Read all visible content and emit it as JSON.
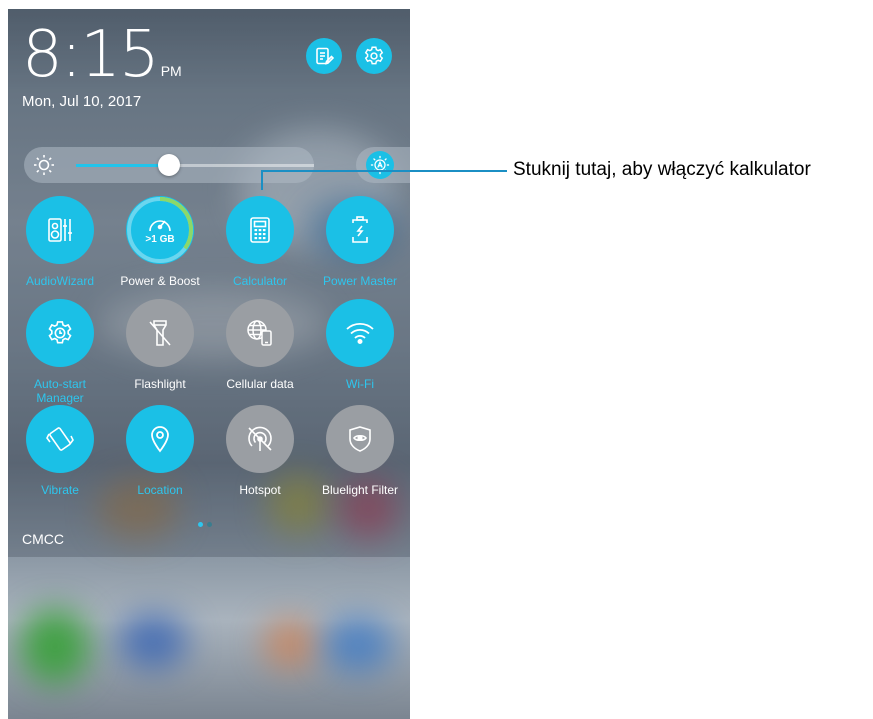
{
  "status": {
    "time_hm": "8:15",
    "ampm": "PM",
    "date": "Mon, Jul 10, 2017",
    "carrier": "CMCC"
  },
  "top_actions": [
    {
      "name": "notes-button",
      "icon": "notes-edit-icon"
    },
    {
      "name": "settings-button",
      "icon": "gear-icon"
    }
  ],
  "brightness": {
    "level_fraction": 0.39,
    "auto_icon": "auto-brightness-icon"
  },
  "tiles": [
    {
      "key": "audiowizard",
      "label": "AudioWizard",
      "state": "on",
      "icon": "speaker-eq-icon"
    },
    {
      "key": "power-boost",
      "label": "Power & Boost",
      "state": "on",
      "icon": "speedometer-icon",
      "meter_text": ">1 GB",
      "ring_fraction": 0.35
    },
    {
      "key": "calculator",
      "label": "Calculator",
      "state": "on",
      "icon": "calculator-icon"
    },
    {
      "key": "power-master",
      "label": "Power Master",
      "state": "on",
      "icon": "battery-icon"
    },
    {
      "key": "auto-start-manager",
      "label": "Auto-start Manager",
      "state": "on",
      "icon": "gear-clock-icon"
    },
    {
      "key": "flashlight",
      "label": "Flashlight",
      "state": "off",
      "icon": "flashlight-off-icon"
    },
    {
      "key": "cellular-data",
      "label": "Cellular data",
      "state": "off",
      "icon": "globe-phone-icon"
    },
    {
      "key": "wifi",
      "label": "Wi-Fi",
      "state": "on",
      "icon": "wifi-icon"
    },
    {
      "key": "vibrate",
      "label": "Vibrate",
      "state": "on",
      "icon": "vibrate-icon"
    },
    {
      "key": "location",
      "label": "Location",
      "state": "on",
      "icon": "location-pin-icon"
    },
    {
      "key": "hotspot",
      "label": "Hotspot",
      "state": "off",
      "icon": "hotspot-off-icon"
    },
    {
      "key": "bluelight-filter",
      "label": "Bluelight Filter",
      "state": "off",
      "icon": "eye-shield-icon"
    }
  ],
  "pager": {
    "pages": 2,
    "current": 1
  },
  "callout": {
    "text": "Stuknij tutaj, aby włączyć kalkulator"
  },
  "colors": {
    "accent": "#1bc0e6",
    "accent_label": "#2ec6ee",
    "tile_off": "#9a9ea3",
    "callout_line": "#1b8fc4"
  }
}
